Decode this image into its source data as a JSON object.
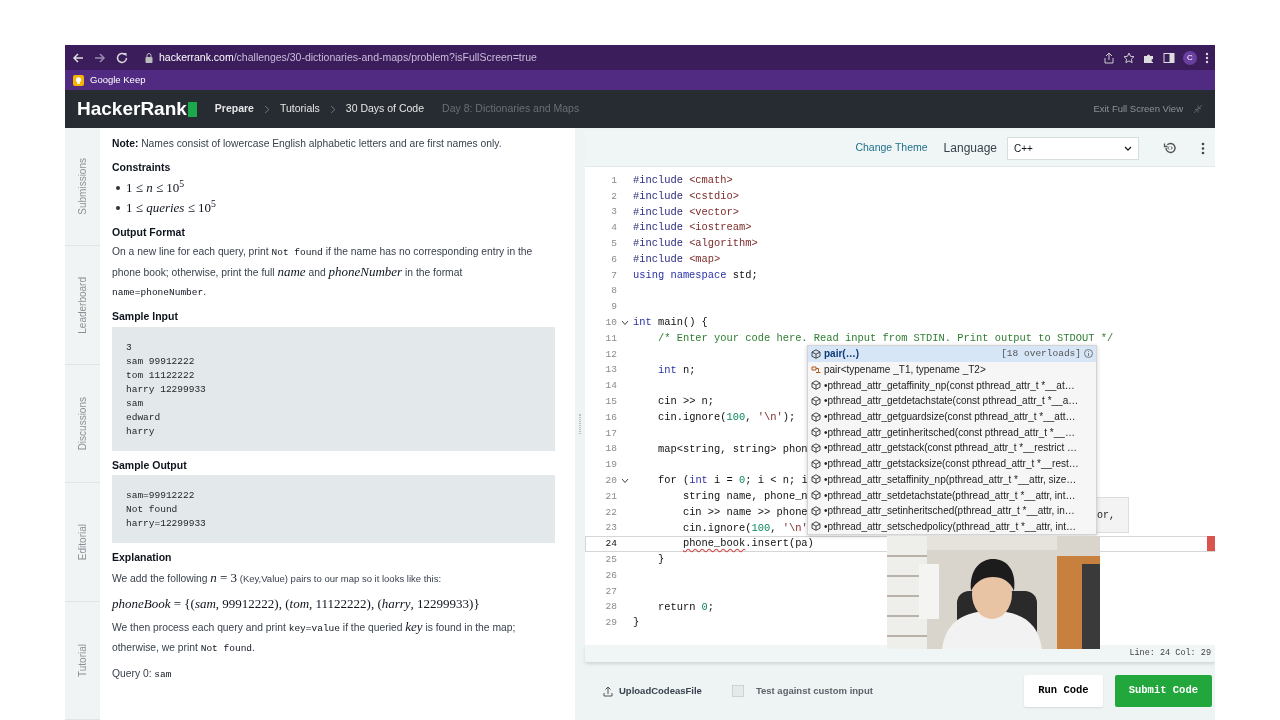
{
  "browser": {
    "url_host": "hackerrank.com",
    "url_path": "/challenges/30-dictionaries-and-maps/problem?isFullScreen=true",
    "profile": "C",
    "bookmarks": [
      {
        "label": "Google Keep"
      }
    ]
  },
  "navbar": {
    "logo": "HackerRank",
    "breadcrumbs": [
      {
        "label": "Prepare",
        "current": false,
        "bold": true
      },
      {
        "label": "Tutorials",
        "current": false,
        "bold": false
      },
      {
        "label": "30 Days of Code",
        "current": false,
        "bold": false
      },
      {
        "label": "Day 8: Dictionaries and Maps",
        "current": true,
        "bold": false
      }
    ],
    "exit_label": "Exit Full Screen View"
  },
  "side_tabs": [
    "Submissions",
    "Leaderboard",
    "Discussions",
    "Editorial",
    "Tutorial"
  ],
  "problem": [
    {
      "kind": "para",
      "parts": [
        {
          "kind": "bold",
          "text": "Note:"
        },
        {
          "kind": "text",
          "text": " Names consist of lowercase English alphabetic letters and are first names only."
        }
      ]
    },
    {
      "kind": "heading",
      "text": "Constraints"
    },
    {
      "kind": "list",
      "items": [
        "1 ≤ *n* ≤ 10$^{5}$",
        "1 ≤ *queries* ≤ 10$^{5}$"
      ]
    },
    {
      "kind": "heading",
      "text": "Output Format"
    },
    {
      "kind": "para",
      "parts": [
        {
          "kind": "text",
          "text": "On a new line for each query, print "
        },
        {
          "kind": "code",
          "text": "Not found"
        },
        {
          "kind": "text",
          "text": " if the name has no corresponding entry in the phone book; otherwise, print the full "
        },
        {
          "kind": "math",
          "text": "*name*"
        },
        {
          "kind": "text",
          "text": " and "
        },
        {
          "kind": "math",
          "text": "*phoneNumber*"
        },
        {
          "kind": "text",
          "text": " in the format "
        },
        {
          "kind": "code",
          "text": "name=phoneNumber"
        },
        {
          "kind": "text",
          "text": "."
        }
      ]
    },
    {
      "kind": "heading",
      "text": "Sample Input"
    },
    {
      "kind": "pre",
      "lines": [
        "3",
        "sam 99912222",
        "tom 11122222",
        "harry 12299933",
        "sam",
        "edward",
        "harry"
      ]
    },
    {
      "kind": "heading",
      "text": "Sample Output"
    },
    {
      "kind": "pre",
      "lines": [
        "sam=99912222",
        "Not found",
        "harry=12299933"
      ]
    },
    {
      "kind": "heading",
      "text": "Explanation"
    },
    {
      "kind": "para",
      "parts": [
        {
          "kind": "text",
          "text": "We add the following "
        },
        {
          "kind": "math",
          "text": "*n* = 3"
        },
        {
          "kind": "small",
          "text": " (Key,Value) pairs to our map so it looks like this:"
        }
      ]
    },
    {
      "kind": "mathline",
      "text": "*phoneBook* = {(*sam*, 99912222), (*tom*, 11122222), (*harry*, 12299933)}"
    },
    {
      "kind": "para",
      "parts": [
        {
          "kind": "text",
          "text": "We then process each query and print "
        },
        {
          "kind": "code",
          "text": "key=value"
        },
        {
          "kind": "text",
          "text": " if the queried "
        },
        {
          "kind": "math",
          "text": "*key*"
        },
        {
          "kind": "text",
          "text": " is found in the map; otherwise, we print "
        },
        {
          "kind": "code",
          "text": "Not found"
        },
        {
          "kind": "text",
          "text": "."
        }
      ]
    },
    {
      "kind": "para",
      "parts": [
        {
          "kind": "text",
          "text": "Query 0: "
        },
        {
          "kind": "code",
          "text": "sam"
        }
      ]
    }
  ],
  "editor": {
    "change_theme": "Change Theme",
    "language_label": "Language",
    "language": "C++",
    "lines": [
      {
        "num": "1",
        "segs": [
          {
            "kind": "pre",
            "t": "#include "
          },
          {
            "kind": "str",
            "t": "<cmath>"
          }
        ]
      },
      {
        "num": "2",
        "segs": [
          {
            "kind": "pre",
            "t": "#include "
          },
          {
            "kind": "str",
            "t": "<cstdio>"
          }
        ]
      },
      {
        "num": "3",
        "segs": [
          {
            "kind": "pre",
            "t": "#include "
          },
          {
            "kind": "str",
            "t": "<vector>"
          }
        ]
      },
      {
        "num": "4",
        "segs": [
          {
            "kind": "pre",
            "t": "#include "
          },
          {
            "kind": "str",
            "t": "<iostream>"
          }
        ]
      },
      {
        "num": "5",
        "segs": [
          {
            "kind": "pre",
            "t": "#include "
          },
          {
            "kind": "str",
            "t": "<algorithm>"
          }
        ]
      },
      {
        "num": "6",
        "segs": [
          {
            "kind": "pre",
            "t": "#include "
          },
          {
            "kind": "str",
            "t": "<map>"
          }
        ]
      },
      {
        "num": "7",
        "segs": [
          {
            "kind": "kw",
            "t": "using namespace"
          },
          {
            "kind": "plain",
            "t": " std;"
          }
        ]
      },
      {
        "num": "8"
      },
      {
        "num": "9"
      },
      {
        "num": "10",
        "expanded": true,
        "segs": [
          {
            "kind": "kw",
            "t": "int"
          },
          {
            "kind": "plain",
            "t": " main() {"
          }
        ]
      },
      {
        "num": "11",
        "segs": [
          {
            "kind": "comment",
            "t": "    /* Enter your code here. Read input from STDIN. Print output to STDOUT */"
          }
        ]
      },
      {
        "num": "12"
      },
      {
        "num": "13",
        "segs": [
          {
            "kind": "kw",
            "t": "    int"
          },
          {
            "kind": "plain",
            "t": " n;"
          }
        ]
      },
      {
        "num": "14"
      },
      {
        "num": "15",
        "segs": [
          {
            "kind": "plain",
            "t": "    cin >> n;"
          }
        ]
      },
      {
        "num": "16",
        "segs": [
          {
            "kind": "plain",
            "t": "    cin.ignore("
          },
          {
            "kind": "num",
            "t": "100"
          },
          {
            "kind": "plain",
            "t": ", "
          },
          {
            "kind": "str",
            "t": "'\\n'"
          },
          {
            "kind": "plain",
            "t": ");"
          }
        ]
      },
      {
        "num": "17"
      },
      {
        "num": "18",
        "segs": [
          {
            "kind": "plain",
            "t": "    map<string, string> phon"
          }
        ]
      },
      {
        "num": "19"
      },
      {
        "num": "20",
        "expanded": true,
        "segs": [
          {
            "kind": "plain",
            "t": "    for ("
          },
          {
            "kind": "kw",
            "t": "int"
          },
          {
            "kind": "plain",
            "t": " i = "
          },
          {
            "kind": "num",
            "t": "0"
          },
          {
            "kind": "plain",
            "t": "; i < n; i"
          }
        ]
      },
      {
        "num": "21",
        "segs": [
          {
            "kind": "plain",
            "t": "        string name, phone_n"
          }
        ]
      },
      {
        "num": "22",
        "segs": [
          {
            "kind": "plain",
            "t": "        cin >> name >> phone"
          }
        ]
      },
      {
        "num": "23",
        "segs": [
          {
            "kind": "plain",
            "t": "        cin.ignore("
          },
          {
            "kind": "num",
            "t": "100"
          },
          {
            "kind": "plain",
            "t": ", "
          },
          {
            "kind": "str",
            "t": "'\\n'"
          }
        ]
      },
      {
        "num": "24",
        "active": true,
        "segs": [
          {
            "kind": "err",
            "t": "        phone_book"
          },
          {
            "kind": "plain",
            "t": ".insert(pa)"
          }
        ]
      },
      {
        "num": "25",
        "segs": [
          {
            "kind": "plain",
            "t": "    }"
          }
        ]
      },
      {
        "num": "26"
      },
      {
        "num": "27"
      },
      {
        "num": "28",
        "segs": [
          {
            "kind": "plain",
            "t": "    return "
          },
          {
            "kind": "num",
            "t": "0"
          },
          {
            "kind": "plain",
            "t": ";"
          }
        ]
      },
      {
        "num": "29",
        "segs": [
          {
            "kind": "plain",
            "t": "}"
          }
        ]
      }
    ],
    "autocomplete": {
      "overloads": "[18 overloads]",
      "items": [
        {
          "kind": "method",
          "text": "pair(…)",
          "selected": true
        },
        {
          "kind": "struct",
          "text": "pair<typename _T1, typename _T2>",
          "selected": false
        },
        {
          "kind": "method",
          "text": "•pthread_attr_getaffinity_np(const pthread_attr_t *__at…",
          "selected": false
        },
        {
          "kind": "method",
          "text": "•pthread_attr_getdetachstate(const pthread_attr_t *__a…",
          "selected": false
        },
        {
          "kind": "method",
          "text": "•pthread_attr_getguardsize(const pthread_attr_t *__att…",
          "selected": false
        },
        {
          "kind": "method",
          "text": "•pthread_attr_getinheritsched(const pthread_attr_t *__…",
          "selected": false
        },
        {
          "kind": "method",
          "text": "•pthread_attr_getstack(const pthread_attr_t *__restrict …",
          "selected": false
        },
        {
          "kind": "method",
          "text": "•pthread_attr_getstacksize(const pthread_attr_t *__rest…",
          "selected": false
        },
        {
          "kind": "method",
          "text": "•pthread_attr_setaffinity_np(pthread_attr_t *__attr, size…",
          "selected": false
        },
        {
          "kind": "method",
          "text": "•pthread_attr_setdetachstate(pthread_attr_t *__attr, int…",
          "selected": false
        },
        {
          "kind": "method",
          "text": "•pthread_attr_setinheritsched(pthread_attr_t *__attr, in…",
          "selected": false
        },
        {
          "kind": "method",
          "text": "•pthread_attr_setschedpolicy(pthread_attr_t *__attr, int…",
          "selected": false
        }
      ]
    },
    "hint": "or,",
    "status": "Line: 24 Col: 29"
  },
  "footer": {
    "upload": "UploadCodeasFile",
    "custom_input": {
      "label": "Test against custom input",
      "checked": false
    },
    "run": "Run Code",
    "submit": "Submit Code"
  }
}
